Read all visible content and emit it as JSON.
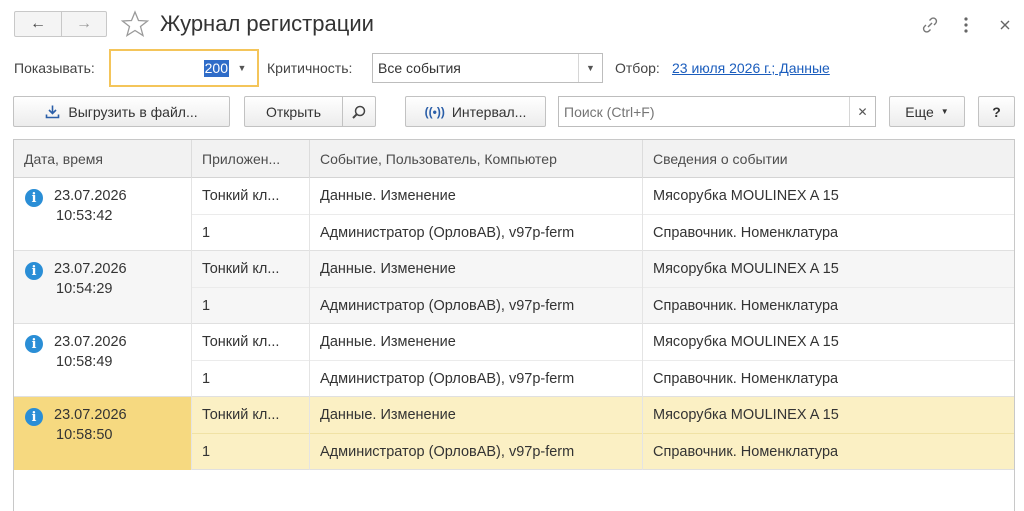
{
  "window": {
    "title": "Журнал регистрации",
    "back_icon": "←",
    "forward_icon": "→"
  },
  "filters": {
    "show_label": "Показывать:",
    "show_count": "200",
    "severity_label": "Критичность:",
    "severity_value": "Все события",
    "selection_label": "Отбор:",
    "selection_link": "23 июля 2026 г.; Данные"
  },
  "toolbar": {
    "export_label": "Выгрузить в файл...",
    "open_label": "Открыть",
    "interval_label": "Интервал...",
    "search_placeholder": "Поиск (Ctrl+F)",
    "more_label": "Еще",
    "help_label": "?"
  },
  "table": {
    "columns": [
      "Дата, время",
      "Приложен...",
      "Событие, Пользователь, Компьютер",
      "Сведения о событии"
    ],
    "rows": [
      {
        "date": "23.07.2026",
        "time": "10:53:42",
        "app": "Тонкий кл...",
        "session": "1",
        "event": "Данные. Изменение",
        "user": "Администратор (ОрловАВ), v97p-ferm",
        "info": "Мясорубка MOULINEX  A 15",
        "metadata": "Справочник. Номенклатура"
      },
      {
        "date": "23.07.2026",
        "time": "10:54:29",
        "app": "Тонкий кл...",
        "session": "1",
        "event": "Данные. Изменение",
        "user": "Администратор (ОрловАВ), v97p-ferm",
        "info": "Мясорубка MOULINEX  A 15",
        "metadata": "Справочник. Номенклатура"
      },
      {
        "date": "23.07.2026",
        "time": "10:58:49",
        "app": "Тонкий кл...",
        "session": "1",
        "event": "Данные. Изменение",
        "user": "Администратор (ОрловАВ), v97p-ferm",
        "info": "Мясорубка MOULINEX  A 15",
        "metadata": "Справочник. Номенклатура"
      },
      {
        "date": "23.07.2026",
        "time": "10:58:50",
        "app": "Тонкий кл...",
        "session": "1",
        "event": "Данные. Изменение",
        "user": "Администратор (ОрловАВ), v97p-ferm",
        "info": "Мясорубка MOULINEX  A 15",
        "metadata": "Справочник. Номенклатура"
      }
    ],
    "selected_row": 3
  },
  "colors": {
    "accent_border": "#f4c55a",
    "link": "#1b5dbd",
    "info_icon": "#2a8ed6",
    "selected_row": "#fbf0c4",
    "selected_cell": "#f6d980"
  }
}
